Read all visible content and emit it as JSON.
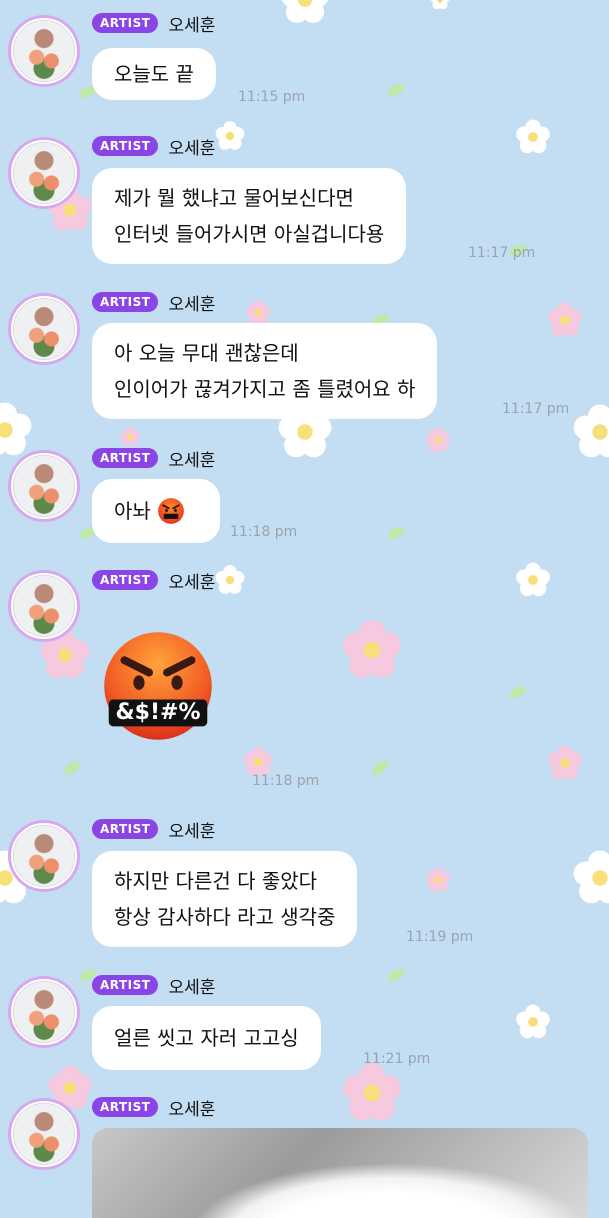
{
  "chat": {
    "messages": [
      {
        "badge": "ARTIST",
        "name": "오세훈",
        "lines": [
          "오늘도 끝"
        ],
        "time": "11:15 pm"
      },
      {
        "badge": "ARTIST",
        "name": "오세훈",
        "lines": [
          "제가 뭘 했냐고 물어보신다면",
          "인터넷 들어가시면 아실겁니다용"
        ],
        "time": "11:17 pm"
      },
      {
        "badge": "ARTIST",
        "name": "오세훈",
        "lines": [
          "아 오늘 무대 괜찮은데",
          "인이어가 끊겨가지고 좀 틀렸어요 하"
        ],
        "time": "11:17 pm"
      },
      {
        "badge": "ARTIST",
        "name": "오세훈",
        "lines": [
          "아놔"
        ],
        "time": "11:18 pm",
        "emoji": "angry-face-with-symbols-icon"
      },
      {
        "badge": "ARTIST",
        "name": "오세훈",
        "sticker": "angry-face-with-symbols-icon",
        "sticker_text": "&$!#%",
        "time": "11:18 pm"
      },
      {
        "badge": "ARTIST",
        "name": "오세훈",
        "lines": [
          "하지만 다른건 다 좋았다",
          "항상 감사하다 라고 생각중"
        ],
        "time": "11:19 pm"
      },
      {
        "badge": "ARTIST",
        "name": "오세훈",
        "lines": [
          "얼른 씻고 자러 고고싱"
        ],
        "time": "11:21 pm"
      },
      {
        "badge": "ARTIST",
        "name": "오세훈",
        "photo": "photo-attachment"
      }
    ]
  },
  "colors": {
    "background": "#c3ddf3",
    "badge": "#8a45e6",
    "avatar_ring": "#d7a8ee",
    "bubble": "#ffffff",
    "time": "#9aa3ab"
  }
}
